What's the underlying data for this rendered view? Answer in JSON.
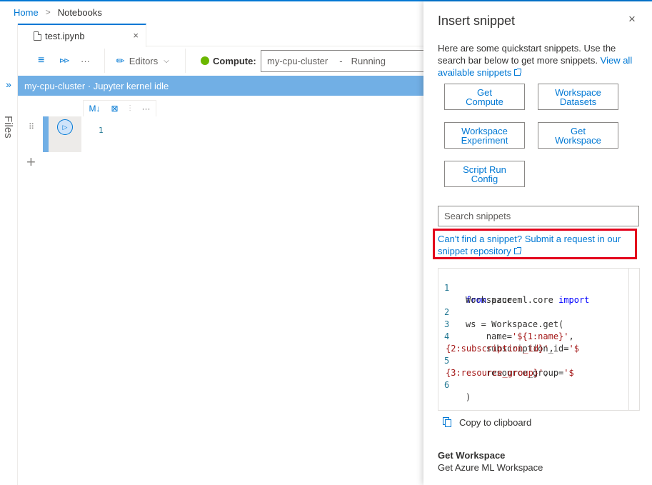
{
  "breadcrumb": {
    "home": "Home",
    "separator": ">",
    "current": "Notebooks"
  },
  "rail": {
    "expand_icon": "double-chevron-right-icon",
    "files_label": "Files"
  },
  "tab": {
    "label": "test.ipynb",
    "close": "×"
  },
  "toolbar": {
    "menu_icon": "≡",
    "run_all_icon": "⊳⊳",
    "more": "···",
    "editors_label": "Editors",
    "compute_label": "Compute:",
    "compute_name": "my-cpu-cluster",
    "compute_sep": "-",
    "compute_status": "Running",
    "compute_status_color": "#6bb700"
  },
  "kernel": {
    "status_text": "my-cpu-cluster · Jupyter kernel idle"
  },
  "cell": {
    "toolbar_md": "M↓",
    "line_number": "1",
    "more": "···",
    "add": "+"
  },
  "panel": {
    "title": "Insert snippet",
    "close": "×",
    "desc_prefix": "Here are some quickstart snippets. Use the search bar below to get more snippets.",
    "desc_link": "View all available snippets",
    "buttons": [
      {
        "line1": "Get",
        "line2": "Compute"
      },
      {
        "line1": "Workspace",
        "line2": "Datasets"
      },
      {
        "line1": "Workspace",
        "line2": "Experiment"
      },
      {
        "line1": "Get",
        "line2": "Workspace"
      },
      {
        "line1": "Script Run",
        "line2": "Config"
      }
    ],
    "search_placeholder": "Search snippets",
    "cant_find_line1": "Can't find a snippet? Submit a request in our",
    "cant_find_line2": "snippet repository",
    "code": {
      "l1_num": "1",
      "l1_kw": "from",
      "l1_mod": " azureml.core ",
      "l1_kw2": "import",
      "l1b": "Workspace",
      "l2_num": "2",
      "l2": "ws = Workspace.get(",
      "l3_num": "3",
      "l3_a": "    name=",
      "l3_s": "'${1:name}'",
      "l3_c": ",",
      "l4_num": "4",
      "l4_a": "    subscription_id=",
      "l4_s": "'$",
      "l4b_s": "{2:subscription_id}'",
      "l4b_c": ",",
      "l5_num": "5",
      "l5_a": "    resource_group=",
      "l5_s": "'$",
      "l5b_s": "{3:resource_group}'",
      "l5b_c": ",",
      "l6_num": "6",
      "l6": ")"
    },
    "copy_label": "Copy to clipboard",
    "selected_title": "Get Workspace",
    "selected_desc": "Get Azure ML Workspace"
  },
  "colors": {
    "accent": "#0078d4",
    "highlight_border": "#e3001b",
    "kernel_bar": "#71afe5"
  }
}
